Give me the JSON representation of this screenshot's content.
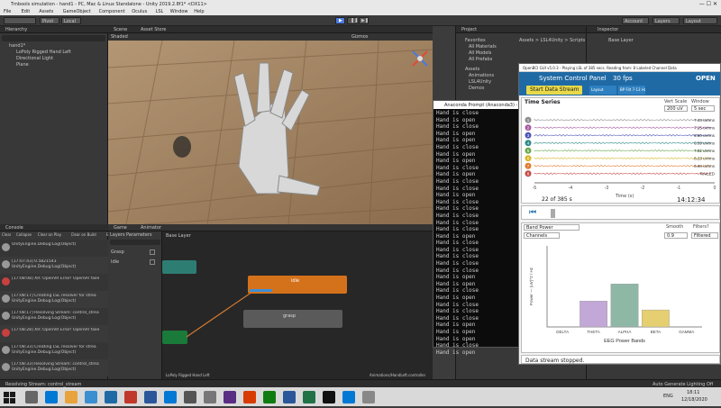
{
  "window": {
    "title": "Tmbools simulation - hand1 - PC, Mac & Linux Standalone - Unity 2019.2.8f1* <DX11>"
  },
  "menu": [
    "File",
    "Edit",
    "Assets",
    "GameObject",
    "Component",
    "Oculus",
    "LSL",
    "Window",
    "Help"
  ],
  "toolbar": {
    "pivot": "Pivot",
    "local": "Local",
    "account": "Account",
    "layers": "Layers",
    "layout": "Layout"
  },
  "hierarchy": {
    "title": "Hierarchy",
    "items": [
      "hand1*",
      "LoPoly Rigged Hand Left",
      "Directional Light",
      "Plane"
    ]
  },
  "scene": {
    "tabs": [
      "Scene",
      "Asset Store"
    ],
    "shading": "Shaded",
    "gizmos": "Gizmos"
  },
  "console": {
    "title": "Console",
    "controls": [
      "Clear",
      "Collapse",
      "Clear on Play",
      "Clear on Build",
      "Error Pause"
    ],
    "entries": [
      "UnityEngine.Debug:Log(Object)",
      "[17:07:43] 0.5821543 UnityEngine.Debug:Log(Object)",
      "[17:08:08] XR: OpenVR Error! OpenVR faile",
      "[17:08:17] Creating LSL resolver for strea UnityEngine.Debug:Log(Object)",
      "[17:08:17] Resolving Stream: control_strea UnityEngine.Debug:Log(Object)",
      "[17:08:28] XR: OpenVR Error! OpenVR faile",
      "[17:08:33] Creating LSL resolver for strea UnityEngine.Debug:Log(Object)",
      "[17:08:33] Resolving Stream: control_strea UnityEngine.Debug:Log(Object)"
    ]
  },
  "animator": {
    "tabs": [
      "Game",
      "Animator"
    ],
    "subtabs": [
      "Layers",
      "Parameters"
    ],
    "base_layer": "Base Layer",
    "params": [
      "Grasp",
      "Idle"
    ],
    "states": {
      "top": "idle",
      "grasp": "grasp"
    },
    "footer_left": "LoPoly Rigged Hand Left",
    "footer_right": "Animations/HandLeft.controller"
  },
  "cmd": {
    "title": "Anaconda Prompt (Anaconda3) - py...",
    "lines": [
      "Hand is close",
      "Hand is open",
      "Hand is close",
      "Hand is open",
      "Hand is open",
      "Hand is close",
      "Hand is open",
      "Hand is open",
      "Hand is close",
      "Hand is open",
      "Hand is close",
      "Hand is close",
      "Hand is open",
      "Hand is close",
      "Hand is close",
      "Hand is close",
      "Hand is close",
      "Hand is close",
      "Hand is open",
      "Hand is close",
      "Hand is close",
      "Hand is close",
      "Hand is close",
      "Hand is close",
      "Hand is open",
      "Hand is open",
      "Hand is close",
      "Hand is open",
      "Hand is close",
      "Hand is close",
      "Hand is close",
      "Hand is open",
      "Hand is open",
      "Hand is open",
      "Hand is close",
      "Hand is open"
    ]
  },
  "project": {
    "title": "Project",
    "favorites": "Favorites",
    "fav_items": [
      "All Materials",
      "All Models",
      "All Prefabs"
    ],
    "assets": "Assets",
    "asset_items": [
      "Animations",
      "LSL4Unity",
      "Demos"
    ],
    "path": "Assets > LSL4Unity > Scripts > Ut"
  },
  "inspector": {
    "title": "Inspector",
    "label": "Base Layer"
  },
  "openbci": {
    "title": "OpenBCI GUI v5.0.3 - Playing LSL of 385 secs. Reading from: 8 Labeled Channel Data",
    "control_panel": "System Control Panel",
    "fps": "30 fps",
    "start_btn": "Start Data Stream",
    "nav1": "Layout",
    "nav2": "BP Filt 7-13 Hz",
    "logo": "OPEN",
    "ts": {
      "title": "Time Series",
      "vert_label": "Vert Scale",
      "window_label": "Window",
      "vert_val": "200 uV",
      "window_val": "5 sec",
      "channels": [
        {
          "n": "1",
          "v": "7.33 uVrms",
          "c": "#8e8e8e"
        },
        {
          "n": "2",
          "v": "7.25 uVrms",
          "c": "#a85da0"
        },
        {
          "n": "3",
          "v": "6.80 uVrms",
          "c": "#4d55b5"
        },
        {
          "n": "4",
          "v": "6.09 uVrms",
          "c": "#2f8a8a"
        },
        {
          "n": "5",
          "v": "7.81 uVrms",
          "c": "#6aa84f"
        },
        {
          "n": "6",
          "v": "8.23 uVrms",
          "c": "#d9b628"
        },
        {
          "n": "7",
          "v": "6.90 uVrms",
          "c": "#e07b2d"
        },
        {
          "n": "8",
          "v": "RAILED",
          "c": "#c94848"
        }
      ],
      "ticks": [
        "-5",
        "-4",
        "-3",
        "-2",
        "-1",
        "0"
      ],
      "xlabel": "Time (s)",
      "count": "22 of 385 s",
      "clock": "14:12:34"
    },
    "band": {
      "title": "Band Power",
      "smooth_label": "Smooth",
      "filter_label": "Filters?",
      "channels_label": "Channels",
      "smooth_val": "0.9",
      "filter_val": "Filtered"
    },
    "status": "Data stream stopped."
  },
  "chart_data": {
    "type": "bar",
    "title": "",
    "xlabel": "EEG Power Bands",
    "ylabel": "Power — (uV)^2 / Hz",
    "categories": [
      "DELTA",
      "THETA",
      "ALPHA",
      "BETA",
      "GAMMA"
    ],
    "values": [
      0,
      3.2,
      5.3,
      2.1,
      0
    ],
    "ylim": [
      0,
      10
    ],
    "colors": [
      "#a0a0a0",
      "#c2a8d6",
      "#8fb7a6",
      "#e6cf70",
      "#cccccc"
    ]
  },
  "statusbar": {
    "left": "Resolving Stream: control_stream",
    "right": "Auto Generate Lighting Off"
  },
  "taskbar": {
    "time": "18:11",
    "date": "12/18/2020",
    "lang": "ENG"
  }
}
